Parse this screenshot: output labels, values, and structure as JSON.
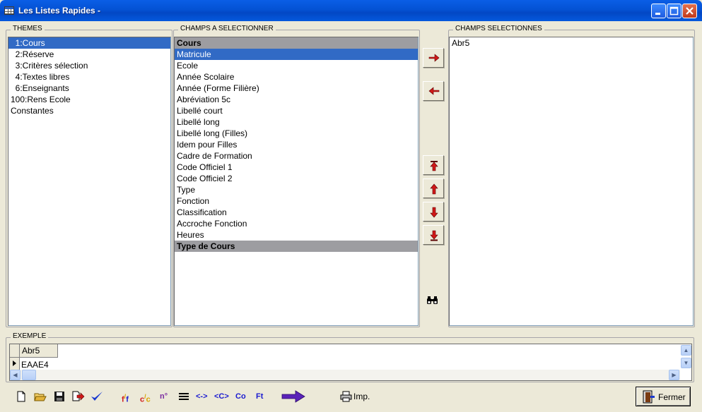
{
  "window": {
    "title": "Les Listes Rapides -"
  },
  "themes": {
    "label": "THEMES",
    "items": [
      "  1:Cours",
      "  2:Réserve",
      "  3:Critères sélection",
      "  4:Textes libres",
      "  6:Enseignants",
      "100:Rens Ecole",
      "Constantes"
    ],
    "selected_index": 0
  },
  "champs": {
    "label": "CHAMPS A SELECTIONNER",
    "rows": [
      {
        "text": "Cours",
        "kind": "header"
      },
      {
        "text": "Matricule",
        "kind": "selected"
      },
      {
        "text": "Ecole",
        "kind": "item"
      },
      {
        "text": "Année Scolaire",
        "kind": "item"
      },
      {
        "text": "Année (Forme Filière)",
        "kind": "item"
      },
      {
        "text": "Abréviation 5c",
        "kind": "item"
      },
      {
        "text": "Libellé court",
        "kind": "item"
      },
      {
        "text": "Libellé long",
        "kind": "item"
      },
      {
        "text": "Libellé long (Filles)",
        "kind": "item"
      },
      {
        "text": "Idem pour Filles",
        "kind": "item"
      },
      {
        "text": "Cadre de Formation",
        "kind": "item"
      },
      {
        "text": "Code Officiel 1",
        "kind": "item"
      },
      {
        "text": "Code Officiel 2",
        "kind": "item"
      },
      {
        "text": "Type",
        "kind": "item"
      },
      {
        "text": "Fonction",
        "kind": "item"
      },
      {
        "text": "Classification",
        "kind": "item"
      },
      {
        "text": "Accroche Fonction",
        "kind": "item"
      },
      {
        "text": "Heures",
        "kind": "item"
      },
      {
        "text": "Type de Cours",
        "kind": "header"
      }
    ]
  },
  "selectionnes": {
    "label": "CHAMPS SELECTIONNES",
    "items": [
      "Abr5"
    ]
  },
  "exemple": {
    "label": "EXEMPLE",
    "column_header": "Abr5",
    "cell_value": "EAAE4"
  },
  "toolbar": {
    "tb_f": "f",
    "tb_c": "c",
    "tb_no": "n°",
    "tb_neq": "<->",
    "tb_cc": "<C>",
    "tb_co": "Co",
    "tb_ft": "Ft",
    "imp_label": "Imp."
  },
  "fermer_label": "Fermer",
  "colors": {
    "selection": "#316ac5",
    "header_row": "#9d9da1",
    "arrow_red": "#d01818"
  }
}
